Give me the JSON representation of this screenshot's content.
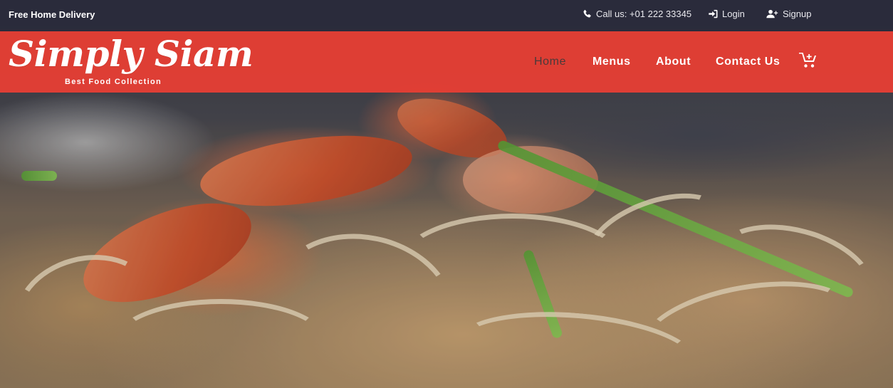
{
  "topbar": {
    "delivery_text": "Free Home Delivery",
    "phone": {
      "icon": "phone-icon",
      "text": "Call us: +01 222 33345"
    },
    "login": {
      "icon": "sign-in-icon",
      "label": "Login"
    },
    "signup": {
      "icon": "user-plus-icon",
      "label": "Signup"
    }
  },
  "header": {
    "brand_name": "Simply Siam",
    "tagline": "Best Food Collection",
    "nav": [
      {
        "label": "Home",
        "active": true
      },
      {
        "label": "Menus",
        "active": false
      },
      {
        "label": "About",
        "active": false
      },
      {
        "label": "Contact Us",
        "active": false
      }
    ],
    "cart_icon": "cart-plus-icon"
  },
  "hero": {
    "image_subject": "pad-thai-with-shrimp"
  },
  "colors": {
    "header_red": "#eb3e34",
    "topbar_bg": "#282a3a",
    "active_nav": "#4a3a3a",
    "text_white": "#ffffff"
  }
}
